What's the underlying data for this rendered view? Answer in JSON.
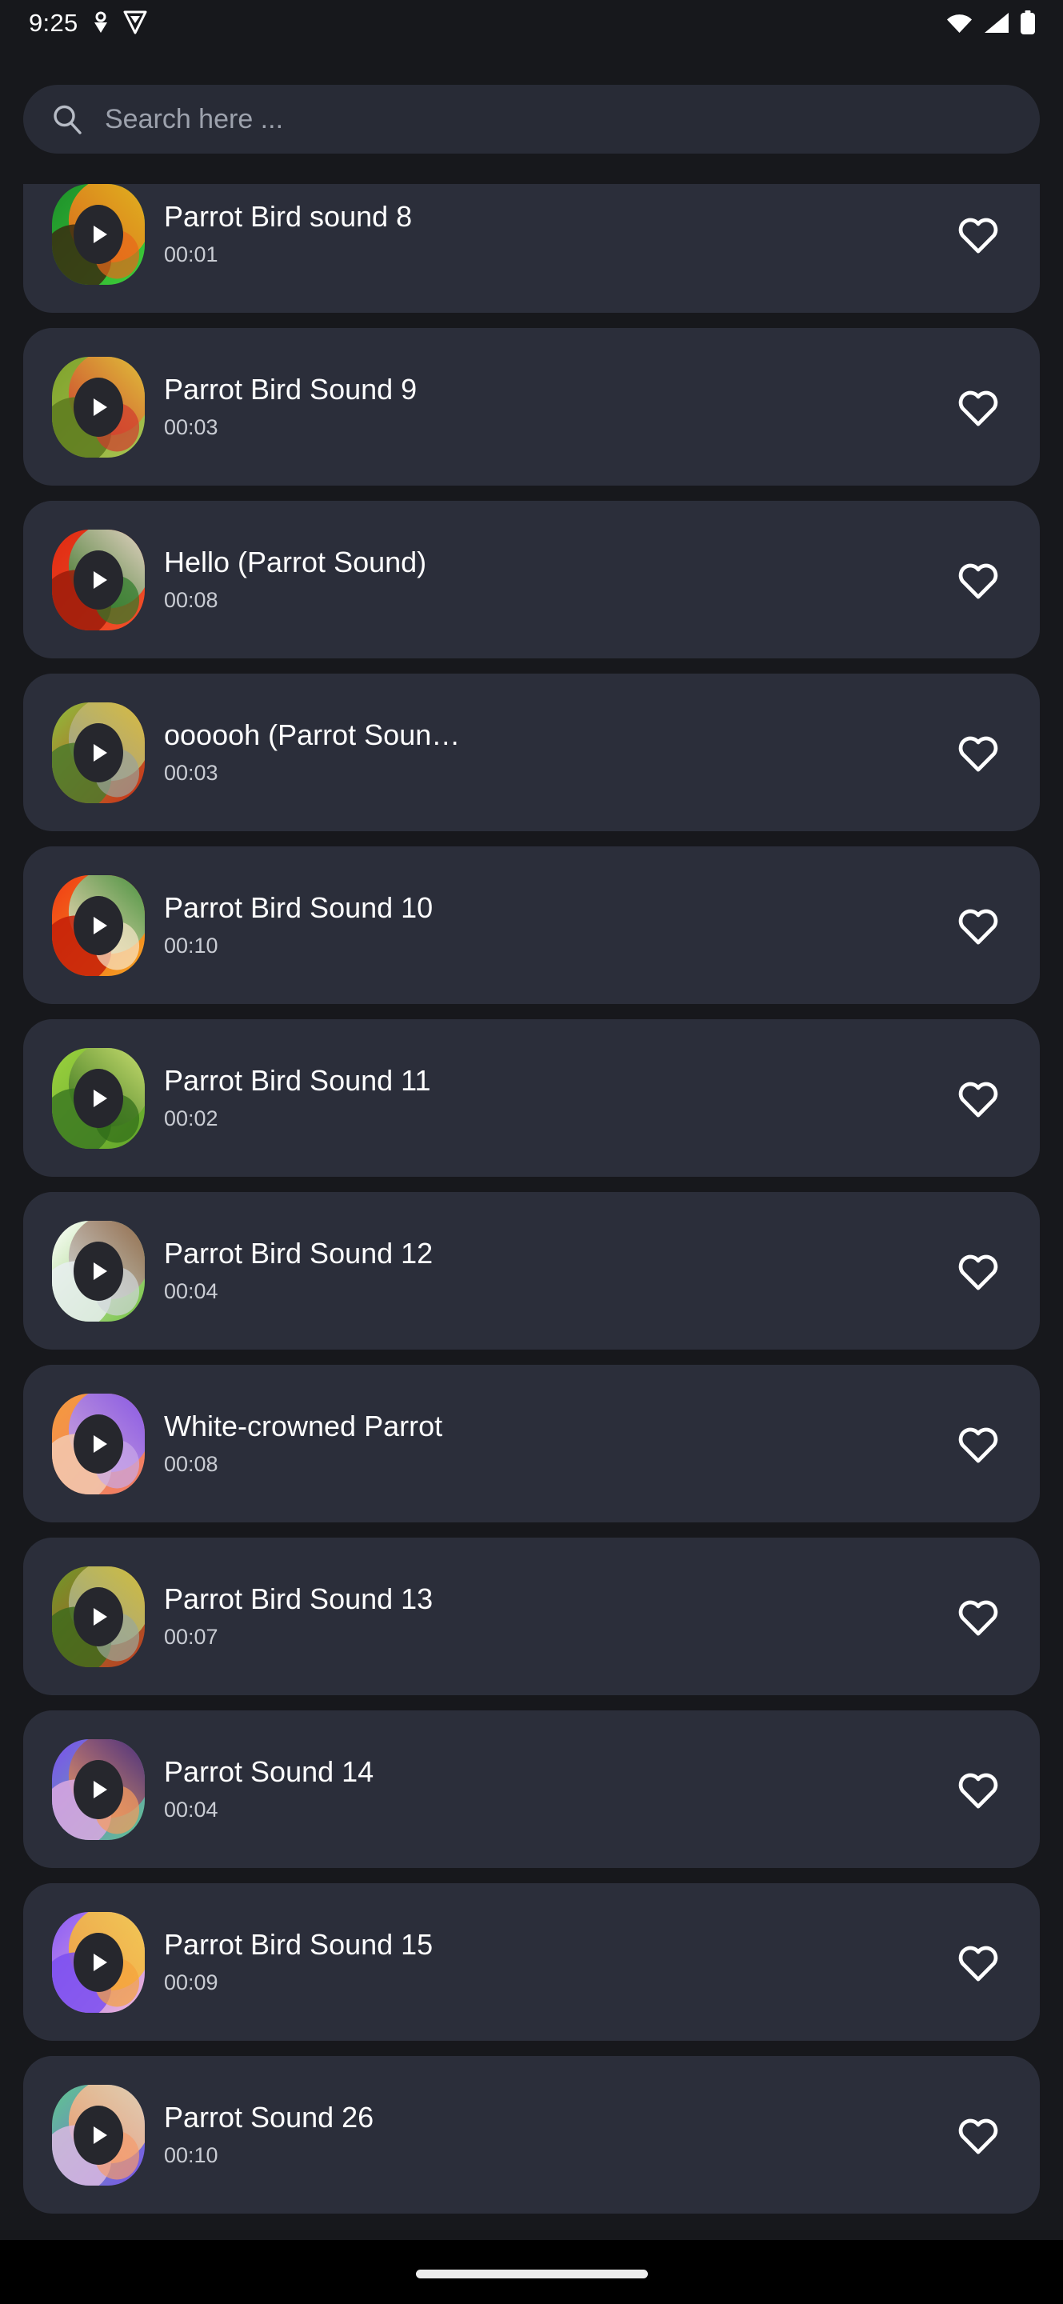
{
  "status_bar": {
    "time": "9:25",
    "left_icons": [
      "location-pin-icon",
      "vpn-shield-icon"
    ],
    "right_icons": [
      "wifi-icon",
      "cellular-signal-icon",
      "battery-icon"
    ]
  },
  "search": {
    "placeholder": "Search here ...",
    "value": "",
    "icon": "search-icon"
  },
  "colors": {
    "page_background": "#17181c",
    "card_background": "#2b2e3a",
    "search_background": "#282b36",
    "title_text": "#ffffff",
    "duration_text": "#c9ccd3",
    "heart_outline": "#ffffff",
    "nav_background": "#000000",
    "nav_pill": "#ededed"
  },
  "list": {
    "favorite_icon": "heart-outline-icon",
    "play_icon": "play-icon",
    "items": [
      {
        "title": "Parrot Bird sound 8",
        "duration": "00:01",
        "favorited": false,
        "thumbnail": "eclectus-parrot-photo",
        "thumb_colors": [
          "#1d8f2a",
          "#3fcf3a",
          "#e8661a",
          "#f0b61e",
          "#3a2d10"
        ]
      },
      {
        "title": "Parrot Bird Sound 9",
        "duration": "00:03",
        "favorited": false,
        "thumbnail": "amazon-parrot-photo",
        "thumb_colors": [
          "#7fa22c",
          "#a8c451",
          "#d13a2e",
          "#e8c93a",
          "#5d7a1e"
        ]
      },
      {
        "title": "Hello (Parrot Sound)",
        "duration": "00:08",
        "favorited": false,
        "thumbnail": "scarlet-macaw-photo",
        "thumb_colors": [
          "#e02b12",
          "#f2512a",
          "#2d7a2a",
          "#efe7dc",
          "#9c1c0a"
        ]
      },
      {
        "title": "oooooh (Parrot Soun…",
        "duration": "00:03",
        "favorited": false,
        "thumbnail": "military-macaw-photo",
        "thumb_colors": [
          "#8dbf3c",
          "#cf2a18",
          "#9aa39a",
          "#e0c43c",
          "#4e7a2c"
        ]
      },
      {
        "title": "Parrot Bird Sound 10",
        "duration": "00:10",
        "favorited": false,
        "thumbnail": "macaw-closeup-photo",
        "thumb_colors": [
          "#f03b14",
          "#f5a623",
          "#f6e6c8",
          "#2f8f3a",
          "#c41f08"
        ]
      },
      {
        "title": "Parrot Bird Sound 11",
        "duration": "00:02",
        "favorited": false,
        "thumbnail": "green-parrot-photo",
        "thumb_colors": [
          "#9bd13e",
          "#5fa32a",
          "#2f6b18",
          "#d9e87a",
          "#3d7a22"
        ]
      },
      {
        "title": "Parrot Bird Sound 12",
        "duration": "00:04",
        "favorited": false,
        "thumbnail": "quaker-parrot-photo",
        "thumb_colors": [
          "#ffffff",
          "#6fbf3a",
          "#cfd6d8",
          "#8a5a3a",
          "#e8eef0"
        ]
      },
      {
        "title": "White-crowned Parrot",
        "duration": "00:08",
        "favorited": false,
        "thumbnail": "gradient-placeholder",
        "thumb_colors": [
          "#f59b3c",
          "#f07a6a",
          "#c9a8e8",
          "#7b4ff0",
          "#f2c9b0"
        ]
      },
      {
        "title": "Parrot Bird Sound 13",
        "duration": "00:07",
        "favorited": false,
        "thumbnail": "amazon-parrot-photo-2",
        "thumb_colors": [
          "#6f9a2a",
          "#c23a22",
          "#9aa89a",
          "#d9c63a",
          "#3f6b1c"
        ]
      },
      {
        "title": "Parrot Sound 14",
        "duration": "00:04",
        "favorited": false,
        "thumbnail": "gradient-placeholder",
        "thumb_colors": [
          "#7b4ff0",
          "#5ec88c",
          "#f59b5c",
          "#3b1f7a",
          "#d9a8e0"
        ]
      },
      {
        "title": "Parrot Bird Sound 15",
        "duration": "00:09",
        "favorited": false,
        "thumbnail": "gradient-placeholder",
        "thumb_colors": [
          "#8b5cf6",
          "#f0b8d8",
          "#f5a23c",
          "#f5d04a",
          "#7b4ff0"
        ]
      },
      {
        "title": "Parrot Sound 26",
        "duration": "00:10",
        "favorited": false,
        "thumbnail": "gradient-placeholder",
        "thumb_colors": [
          "#5ec88c",
          "#7b4ff0",
          "#f59b6c",
          "#e8d8b8",
          "#d9b8e0"
        ]
      }
    ]
  },
  "navigation_bar": {
    "gesture_pill": "home-gesture-pill"
  }
}
